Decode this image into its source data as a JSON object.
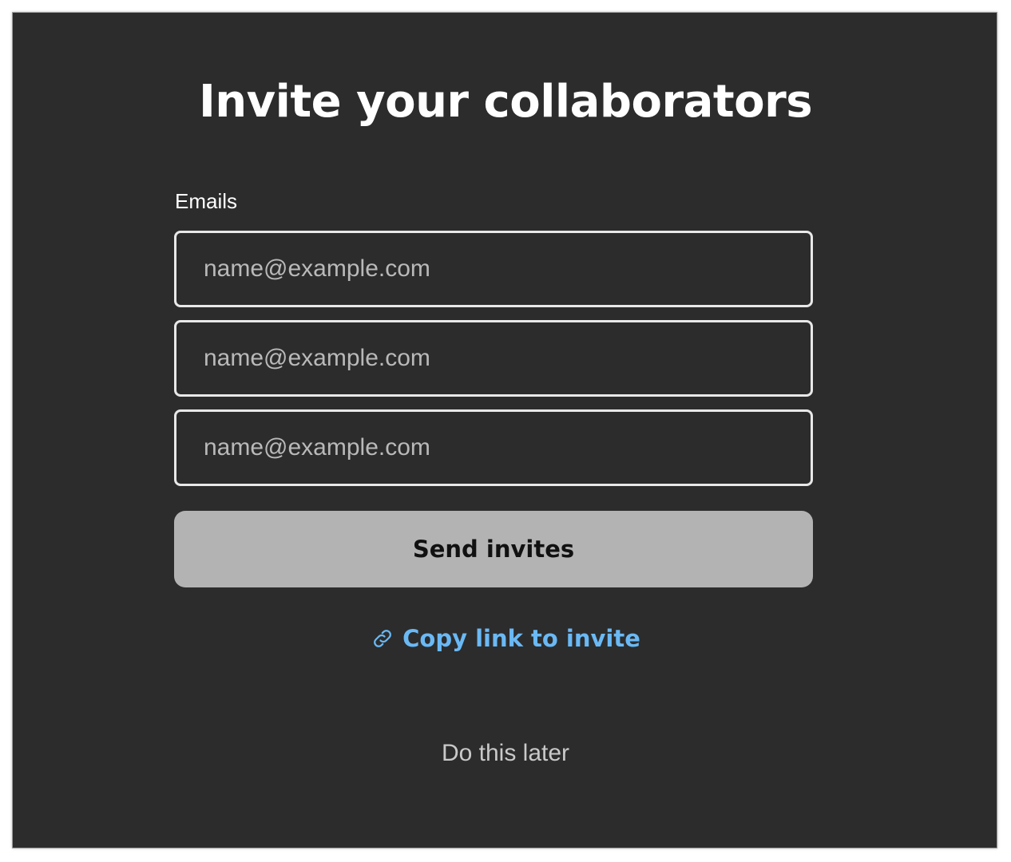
{
  "dialog": {
    "title": "Invite your collaborators",
    "emails_label": "Emails",
    "email_fields": [
      {
        "value": "",
        "placeholder": "name@example.com"
      },
      {
        "value": "",
        "placeholder": "name@example.com"
      },
      {
        "value": "",
        "placeholder": "name@example.com"
      }
    ],
    "send_button_label": "Send invites",
    "copy_link_label": "Copy link to invite",
    "copy_link_icon": "link-icon",
    "later_label": "Do this later"
  },
  "colors": {
    "background": "#2c2c2c",
    "accent_link": "#6ab9f5",
    "button_disabled": "#b3b3b3"
  }
}
